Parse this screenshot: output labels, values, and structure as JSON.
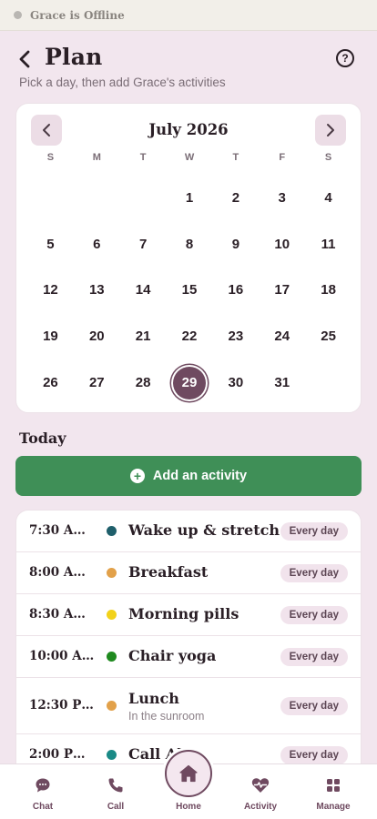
{
  "status": {
    "text": "Grace is Offline",
    "dot_color": "#b9b6b2"
  },
  "header": {
    "title": "Plan",
    "back_icon": "chevron-left-icon",
    "help_icon": "question-circle-icon",
    "help_glyph": "?"
  },
  "subtitle": "Pick a day, then add Grace's activities",
  "calendar": {
    "month": "July 2026",
    "weekdays": [
      "S",
      "M",
      "T",
      "W",
      "T",
      "F",
      "S"
    ],
    "leading_blanks": 3,
    "days": [
      "1",
      "2",
      "3",
      "4",
      "5",
      "6",
      "7",
      "8",
      "9",
      "10",
      "11",
      "12",
      "13",
      "14",
      "15",
      "16",
      "17",
      "18",
      "19",
      "20",
      "21",
      "22",
      "23",
      "24",
      "25",
      "26",
      "27",
      "28",
      "29",
      "30",
      "31"
    ],
    "selected": "29",
    "prev_icon": "chevron-left-icon",
    "next_icon": "chevron-right-icon"
  },
  "today": {
    "label": "Today",
    "add_button": {
      "label": "Add an activity",
      "icon": "plus-circle-icon",
      "color": "#3f8f57"
    }
  },
  "activities": [
    {
      "time": "7:30 AM…",
      "color": "#1f5f6b",
      "title": "Wake up & stretch",
      "subtitle": "",
      "badge": "Every day"
    },
    {
      "time": "8:00 AM…",
      "color": "#e2a14a",
      "title": "Breakfast",
      "subtitle": "",
      "badge": "Every day"
    },
    {
      "time": "8:30 AM…",
      "color": "#f2d21a",
      "title": "Morning pills",
      "subtitle": "",
      "badge": "Every day"
    },
    {
      "time": "10:00 A…",
      "color": "#1f8a1f",
      "title": "Chair yoga",
      "subtitle": "",
      "badge": "Every day"
    },
    {
      "time": "12:30 P…",
      "color": "#e2a14a",
      "title": "Lunch",
      "subtitle": "In the sunroom",
      "badge": "Every day"
    },
    {
      "time": "2:00 PM …",
      "color": "#1a8a86",
      "title": "Call Al",
      "subtitle": "",
      "badge": "Every day"
    }
  ],
  "nav": {
    "items": [
      {
        "label": "Chat",
        "icon": "chat-bubble-icon"
      },
      {
        "label": "Call",
        "icon": "phone-icon"
      },
      {
        "label": "Home",
        "icon": "home-icon"
      },
      {
        "label": "Activity",
        "icon": "heart-pulse-icon"
      },
      {
        "label": "Manage",
        "icon": "grid-icon"
      }
    ],
    "accent": "#6f4a60"
  }
}
